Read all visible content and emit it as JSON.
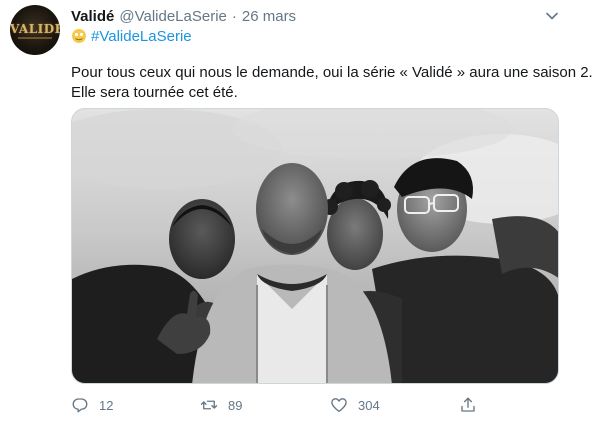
{
  "tweet": {
    "author": {
      "display_name": "Validé",
      "handle": "@ValideLaSerie",
      "avatar_logo_text": "VALIDÉ"
    },
    "date": "26 mars",
    "separator": "·",
    "hashtag": "#ValideLaSerie",
    "text_lines": [
      "Pour tous ceux qui nous le demande, oui la série « Validé » aura une saison 2.",
      "Elle sera tournée cet été."
    ],
    "photo": {
      "style": "black-and-white group portrait of four men against a cloudy sky"
    },
    "actions": {
      "replies": "12",
      "retweets": "89",
      "likes": "304"
    }
  },
  "colors": {
    "text": "#14171a",
    "muted": "#657786",
    "link": "#1b95e0",
    "border": "#ccd6dd"
  },
  "icons": [
    "avatar-logo",
    "chevron-down-icon",
    "emoji-icon",
    "reply-icon",
    "retweet-icon",
    "like-icon",
    "share-icon"
  ]
}
